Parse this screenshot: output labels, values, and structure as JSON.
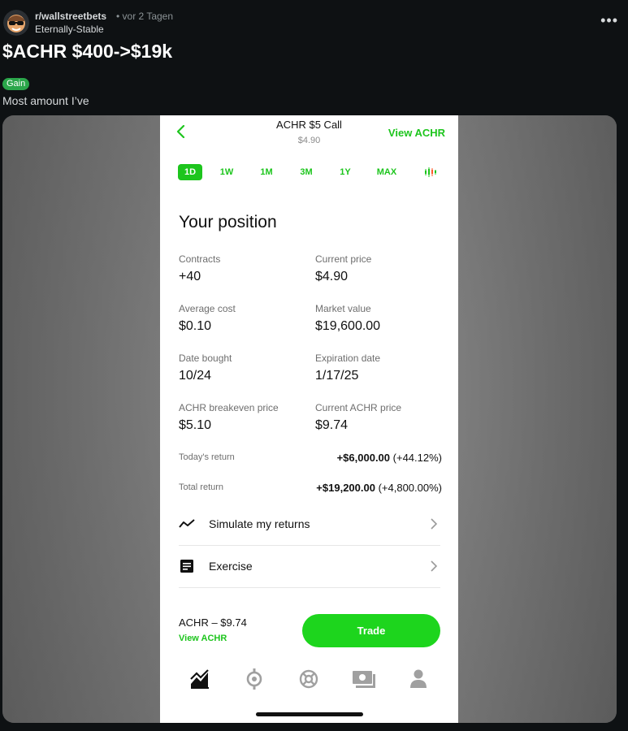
{
  "post": {
    "subreddit": "r/wallstreetbets",
    "time": "• vor 2 Tagen",
    "author": "Eternally-Stable",
    "more_label": "•••",
    "title": "$ACHR $400->$19k",
    "flair": "Gain",
    "body": "Most amount I’ve"
  },
  "phone": {
    "title": "ACHR $5 Call",
    "subtitle": "$4.90",
    "view_link": "View ACHR",
    "ranges": [
      "1D",
      "1W",
      "1M",
      "3M",
      "1Y",
      "MAX"
    ],
    "active_range": "1D",
    "section_title": "Your position",
    "fields": {
      "contracts_label": "Contracts",
      "contracts_value": "+40",
      "current_price_label": "Current price",
      "current_price_value": "$4.90",
      "avg_cost_label": "Average cost",
      "avg_cost_value": "$0.10",
      "market_value_label": "Market value",
      "market_value_value": "$19,600.00",
      "date_bought_label": "Date bought",
      "date_bought_value": "10/24",
      "expiration_label": "Expiration date",
      "expiration_value": "1/17/25",
      "breakeven_label": "ACHR breakeven price",
      "breakeven_value": "$5.10",
      "current_achr_label": "Current ACHR price",
      "current_achr_value": "$9.74"
    },
    "returns": {
      "today_label": "Today's return",
      "today_amount": "+$6,000.00",
      "today_pct": "(+44.12%)",
      "total_label": "Total return",
      "total_amount": "+$19,200.00",
      "total_pct": "(+4,800.00%)"
    },
    "rows": {
      "simulate": "Simulate my returns",
      "exercise": "Exercise"
    },
    "footer": {
      "ticker": "ACHR – $9.74",
      "view": "View ACHR",
      "trade": "Trade"
    },
    "accent": "#1dc51d"
  }
}
